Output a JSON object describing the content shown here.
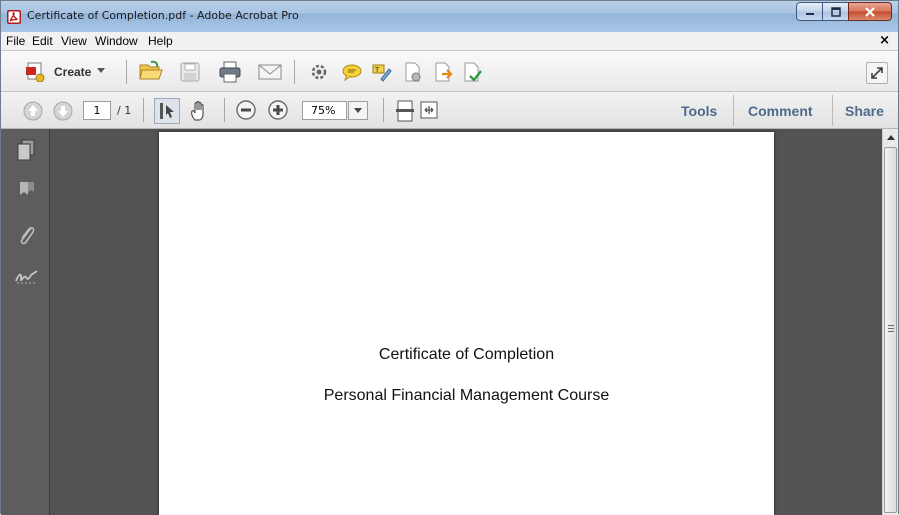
{
  "window": {
    "title": "Certificate of Completion.pdf - Adobe Acrobat Pro"
  },
  "menu": {
    "items": [
      "File",
      "Edit",
      "View",
      "Window",
      "Help"
    ],
    "close_glyph": "×"
  },
  "toolbar": {
    "create_label": "Create",
    "icons": [
      "create-pdf-icon",
      "open-folder-icon",
      "save-icon",
      "print-icon",
      "email-icon",
      "settings-icon",
      "comment-icon",
      "highlight-icon",
      "collaborate-icon",
      "export-icon",
      "combine-icon",
      "expand-icon"
    ]
  },
  "navigation": {
    "current_page": "1",
    "total_pages": "/ 1",
    "zoom": "75%"
  },
  "panes": {
    "tools": "Tools",
    "comment": "Comment",
    "share": "Share"
  },
  "sidebar": {
    "icons": [
      "pages-icon",
      "bookmarks-icon",
      "attachments-icon",
      "signatures-icon"
    ]
  },
  "document": {
    "line1": "Certificate of Completion",
    "line2": "Personal Financial Management Course"
  },
  "colors": {
    "pane_text": "#4d6a8b",
    "workspace": "#535353",
    "navpane": "#5d5d5d"
  }
}
